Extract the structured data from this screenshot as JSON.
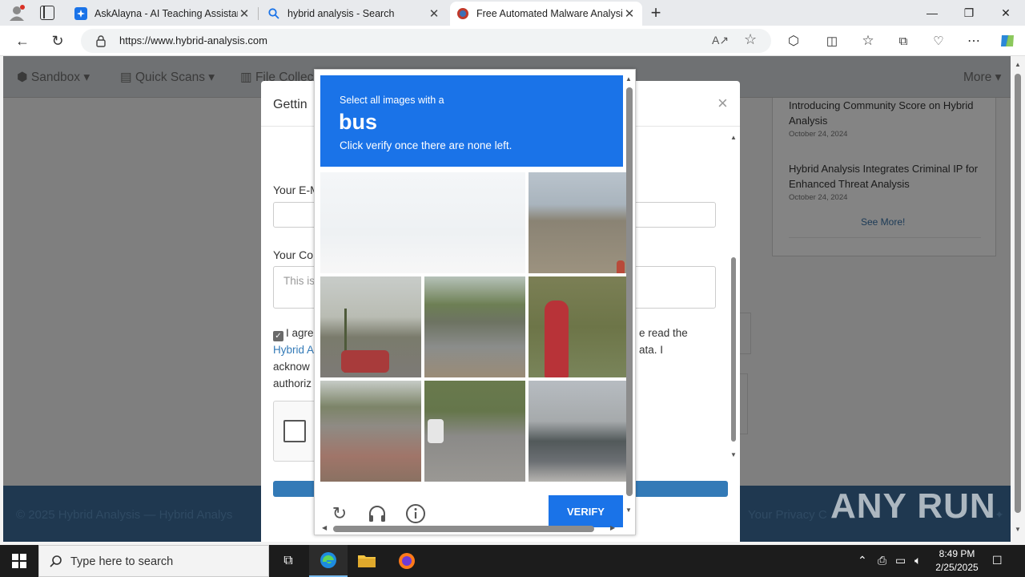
{
  "browser": {
    "tabs": [
      {
        "title": "AskAlayna - AI Teaching Assistan",
        "favicon": "askalayna-icon"
      },
      {
        "title": "hybrid analysis - Search",
        "favicon": "search-icon"
      },
      {
        "title": "Free Automated Malware Analysi",
        "favicon": "hybrid-analysis-icon"
      }
    ],
    "url_domain": "https://www.hybrid-analysis.com",
    "window_controls": [
      "minimize",
      "restore",
      "close"
    ]
  },
  "page": {
    "nav": {
      "sandbox": "Sandbox",
      "quick_scans": "Quick Scans",
      "file_collections": "File Collec",
      "more": "More"
    },
    "news": [
      {
        "headline": "Introducing Community Score on Hybrid Analysis",
        "date": "October 24, 2024"
      },
      {
        "headline": "Hybrid Analysis Integrates Criminal IP for Enhanced Threat Analysis",
        "date": "October 24, 2024"
      }
    ],
    "see_more": "See More!",
    "footer": {
      "copyright": "© 2025 Hybrid Analysis — Hybrid Analys",
      "privacy": "Your Privacy C"
    }
  },
  "modal": {
    "title": "Gettin",
    "email_label": "Your E-M",
    "comment_label": "Your Co",
    "comment_placeholder": "This is",
    "agree_line1": "I agre",
    "agree_line1_end": "e read the",
    "agree_link": "Hybrid A",
    "agree_line2_end": "ata. I",
    "agree_line3": "acknow",
    "agree_line4": "authoriz"
  },
  "captcha": {
    "instruction": "Select all images with a",
    "target": "bus",
    "hint": "Click verify once there are none left.",
    "verify_label": "VERIFY",
    "footer_icons": [
      "reload-icon",
      "audio-icon",
      "info-icon"
    ]
  },
  "taskbar": {
    "search_placeholder": "Type here to search",
    "time": "8:49 PM",
    "date": "2/25/2025"
  },
  "watermark": "ANY RUN"
}
